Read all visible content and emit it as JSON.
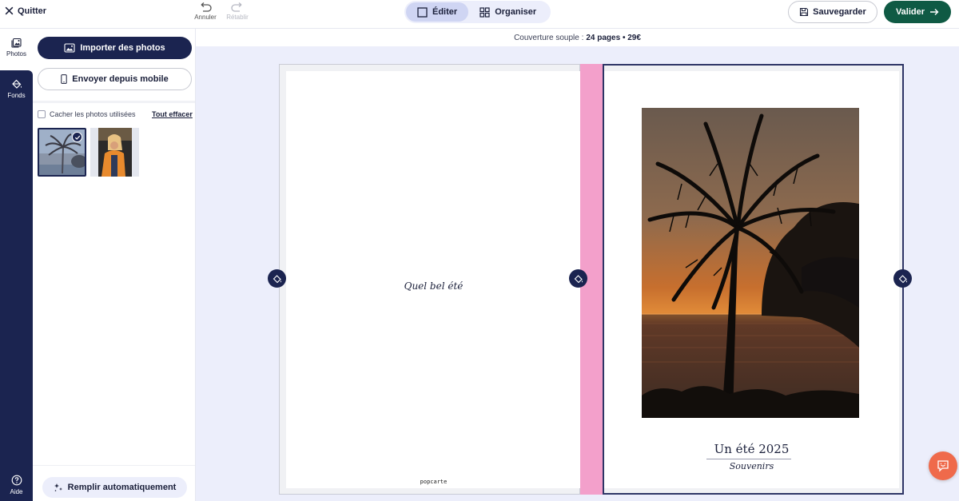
{
  "toolbar": {
    "quit_label": "Quitter",
    "undo_label": "Annuler",
    "redo_label": "Rétablir",
    "modes": {
      "edit_label": "Éditer",
      "organize_label": "Organiser"
    },
    "save_label": "Sauvegarder",
    "validate_label": "Valider"
  },
  "rail": {
    "photos_label": "Photos",
    "backgrounds_label": "Fonds",
    "help_label": "Aide"
  },
  "panel": {
    "import_label": "Importer des photos",
    "mobile_label": "Envoyer depuis mobile",
    "hide_used_label": "Cacher les photos utilisées",
    "clear_all_label": "Tout effacer",
    "autofill_label": "Remplir automatiquement"
  },
  "product": {
    "info_prefix": "Couverture souple :",
    "info_bold": "24 pages • 29€"
  },
  "back_cover": {
    "text": "Quel bel été",
    "brand": "popcarte"
  },
  "front_cover": {
    "title": "Un été 2025",
    "subtitle": "Souvenirs"
  },
  "colors": {
    "navy": "#1b2450",
    "validate_green": "#0f5a44",
    "spine_pink": "#f3a0cb",
    "workspace_bg": "#eceefb",
    "chat_orange": "#ef6a4b"
  }
}
